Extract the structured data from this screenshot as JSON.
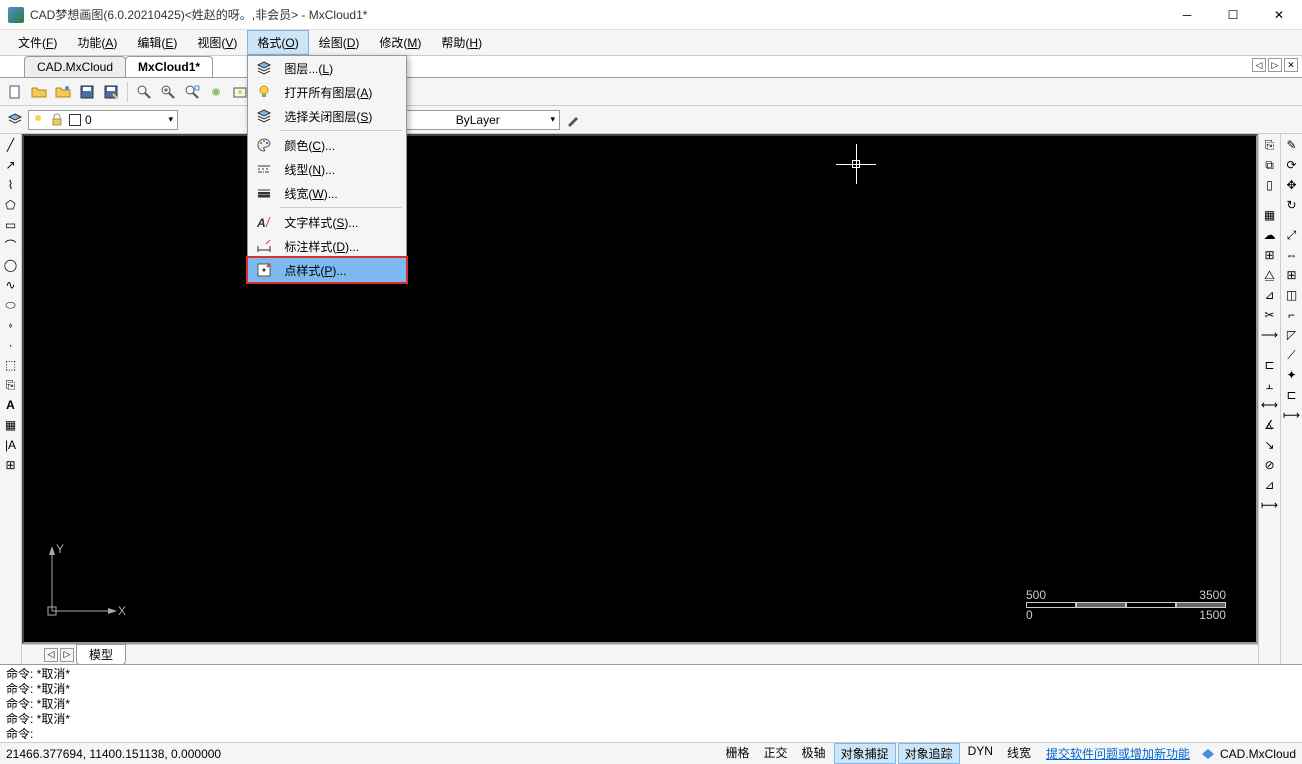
{
  "title": "CAD梦想画图(6.0.20210425)<姓赵的呀。,非会员> - MxCloud1*",
  "menubar": [
    "文件(F)",
    "功能(A)",
    "编辑(E)",
    "视图(V)",
    "格式(O)",
    "绘图(D)",
    "修改(M)",
    "帮助(H)"
  ],
  "open_menu_index": 4,
  "dropdown": {
    "items": [
      {
        "icon": "layers",
        "label": "图层...(L)"
      },
      {
        "icon": "bulb",
        "label": "打开所有图层(A)"
      },
      {
        "icon": "layers",
        "label": "选择关闭图层(S)"
      },
      {
        "sep": true
      },
      {
        "icon": "palette",
        "label": "颜色(C)..."
      },
      {
        "icon": "linetype",
        "label": "线型(N)..."
      },
      {
        "icon": "linewt",
        "label": "线宽(W)..."
      },
      {
        "sep": true
      },
      {
        "icon": "textA",
        "label": "文字样式(S)..."
      },
      {
        "icon": "dim",
        "label": "标注样式(D)..."
      },
      {
        "icon": "point",
        "label": "点样式(P)...",
        "highlight": true
      }
    ]
  },
  "doc_tabs": [
    {
      "label": "CAD.MxCloud",
      "active": false
    },
    {
      "label": "MxCloud1*",
      "active": true
    }
  ],
  "layer_row": {
    "layer": "0",
    "ltype": "ByLayer"
  },
  "bottom_tab": "模型",
  "cmd_lines": [
    "命令:   *取消*",
    "命令:   *取消*",
    "命令:   *取消*",
    "命令:   *取消*",
    "命令:"
  ],
  "status": {
    "coords": "21466.377694,  11400.151138,  0.000000",
    "snaps": [
      {
        "label": "栅格",
        "active": false
      },
      {
        "label": "正交",
        "active": false
      },
      {
        "label": "极轴",
        "active": false
      },
      {
        "label": "对象捕捉",
        "active": true
      },
      {
        "label": "对象追踪",
        "active": true
      },
      {
        "label": "DYN",
        "active": false
      },
      {
        "label": "线宽",
        "active": false
      }
    ],
    "link": "提交软件问题或增加新功能",
    "brand": "CAD.MxCloud"
  },
  "scale": {
    "top_left": "500",
    "top_right": "3500",
    "bot_left": "0",
    "bot_right": "1500"
  }
}
